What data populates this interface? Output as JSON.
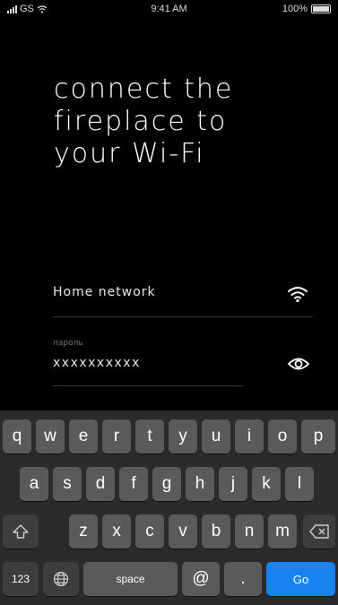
{
  "status": {
    "carrier": "GS",
    "time": "9:41 AM",
    "battery": "100%"
  },
  "title": {
    "line1": "connect the",
    "line2": "fireplace to",
    "line3": "your Wi-Fi"
  },
  "network": {
    "value": "Home network"
  },
  "password": {
    "label": "пароль",
    "value": "xxxxxxxxxx"
  },
  "keyboard": {
    "row1": [
      "q",
      "w",
      "e",
      "r",
      "t",
      "y",
      "u",
      "i",
      "o",
      "p"
    ],
    "row2": [
      "a",
      "s",
      "d",
      "f",
      "g",
      "h",
      "j",
      "k",
      "l"
    ],
    "row3": [
      "z",
      "x",
      "c",
      "v",
      "b",
      "n",
      "m"
    ],
    "num_label": "123",
    "space_label": "space",
    "at_label": "@",
    "dot_label": ".",
    "go_label": "Go"
  },
  "colors": {
    "accent": "#1a82f0",
    "background": "#000000",
    "keyboard_bg": "#2b2b2b"
  }
}
